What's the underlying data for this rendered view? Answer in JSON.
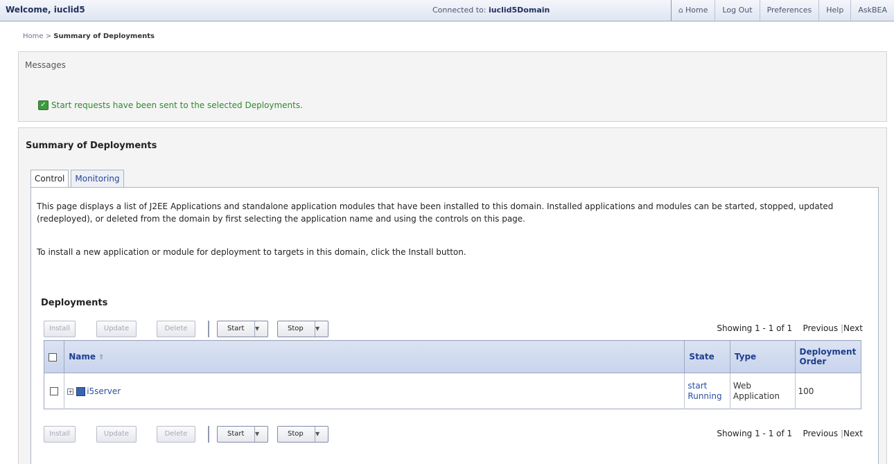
{
  "header": {
    "welcome": "Welcome, iuclid5",
    "connected_label": "Connected to:",
    "domain": "iuclid5Domain",
    "nav": [
      "Home",
      "Log Out",
      "Preferences",
      "Help",
      "AskBEA"
    ]
  },
  "breadcrumb": {
    "home": "Home",
    "separator": ">",
    "current": "Summary of Deployments"
  },
  "messages": {
    "title": "Messages",
    "text": "Start requests have been sent to the selected Deployments."
  },
  "summary": {
    "title": "Summary of Deployments",
    "tabs": [
      "Control",
      "Monitoring"
    ],
    "description": "This page displays a list of J2EE Applications and standalone application modules that have been installed to this domain. Installed applications and modules can be started, stopped, updated (redeployed), or deleted from the domain by first selecting the application name and using the controls on this page.",
    "install_hint": "To install a new application or module for deployment to targets in this domain, click the Install button."
  },
  "deployments": {
    "title": "Deployments",
    "buttons": {
      "install": "Install",
      "update": "Update",
      "delete": "Delete",
      "start": "Start",
      "stop": "Stop"
    },
    "showing": "Showing 1 - 1 of 1",
    "previous": "Previous",
    "next": "Next",
    "columns": [
      "Name",
      "State",
      "Type",
      "Deployment Order"
    ],
    "rows": [
      {
        "name": "i5server",
        "state_action": "start",
        "state": "Running",
        "type": "Web Application",
        "order": "100"
      }
    ]
  },
  "colors": {
    "accent": "#1d3f8f",
    "success": "#2f8a2f"
  }
}
